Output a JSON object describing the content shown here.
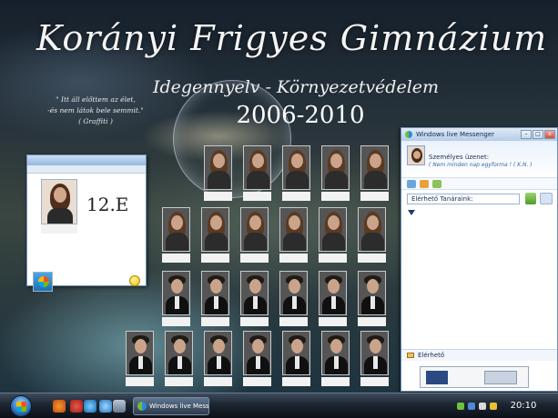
{
  "tableau": {
    "school_title": "Korányi Frigyes Gimnázium",
    "subtitle": "Idegennyelv - Környezetvédelem",
    "years": "2006-2010",
    "quote_lines": [
      "\" Itt áll előttem az élet,",
      "-és nem látok bele semmit.\"",
      "( Graffiti )"
    ],
    "rows": [
      {
        "photos": [
          {
            "caption": "",
            "kind": "female"
          },
          {
            "caption": "",
            "kind": "female"
          },
          {
            "caption": "",
            "kind": "female"
          },
          {
            "caption": "",
            "kind": "female"
          },
          {
            "caption": "",
            "kind": "female"
          }
        ]
      },
      {
        "photos": [
          {
            "caption": "",
            "kind": "female"
          },
          {
            "caption": "",
            "kind": "female"
          },
          {
            "caption": "",
            "kind": "female"
          },
          {
            "caption": "",
            "kind": "female"
          },
          {
            "caption": "",
            "kind": "female"
          },
          {
            "caption": "",
            "kind": "female"
          }
        ]
      },
      {
        "photos": [
          {
            "caption": "",
            "kind": "male"
          },
          {
            "caption": "",
            "kind": "male"
          },
          {
            "caption": "",
            "kind": "male"
          },
          {
            "caption": "",
            "kind": "male"
          },
          {
            "caption": "",
            "kind": "male"
          },
          {
            "caption": "",
            "kind": "male"
          }
        ]
      },
      {
        "photos": [
          {
            "caption": "",
            "kind": "male"
          },
          {
            "caption": "",
            "kind": "male"
          },
          {
            "caption": "",
            "kind": "male"
          },
          {
            "caption": "",
            "kind": "male"
          },
          {
            "caption": "",
            "kind": "male"
          },
          {
            "caption": "",
            "kind": "male"
          },
          {
            "caption": "",
            "kind": "male"
          }
        ]
      }
    ]
  },
  "chat_window": {
    "title": "",
    "menu": "",
    "avatar_caption": "",
    "class_label": "12.E",
    "headline": "",
    "timestamp": "",
    "message": ""
  },
  "messenger": {
    "window_title": "Windows live Messenger",
    "minimize_label": "–",
    "maximize_label": "□",
    "close_label": "x",
    "username": "",
    "status_label": "Személyes üzenet:",
    "status_text": "( Nem minden nap egyforma ! ( K.N. )",
    "search_placeholder": "Elérhető Tanáraink:",
    "roster_left": [],
    "roster_right": [],
    "email_label": "Elérhető"
  },
  "taskbar": {
    "task_button_label": "Windows live Mess...",
    "clock": "20:10"
  },
  "colors": {
    "taskbar": "#1c2530",
    "messenger_header": "#eaf2fb",
    "title_text": "#f4f4f4"
  }
}
